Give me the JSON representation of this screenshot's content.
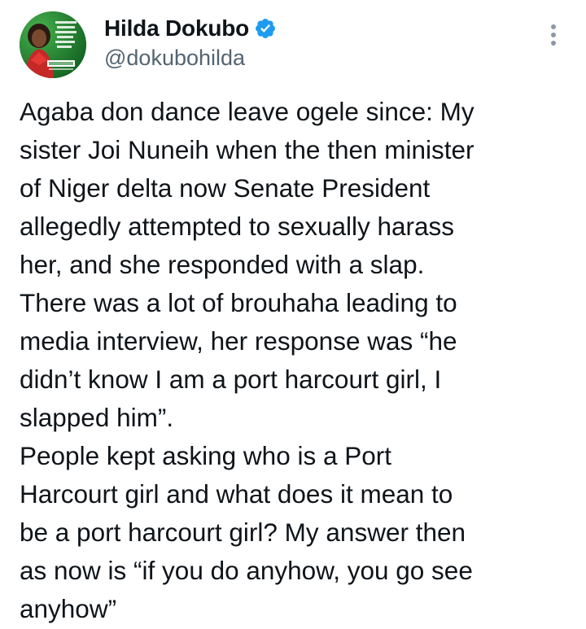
{
  "author": {
    "display_name": "Hilda Dokubo",
    "handle": "@dokubohilda",
    "verified": true,
    "avatar_icon": "profile-photo"
  },
  "menu": {
    "icon": "more-options-icon"
  },
  "tweet": {
    "lines": [
      "Agaba don dance leave ogele since: My",
      "sister Joi Nuneih when the then minister",
      "of Niger delta now Senate President",
      "allegedly attempted to sexually harass",
      "her, and she responded with a slap.",
      "There was a lot of brouhaha leading to",
      "media interview, her response was “he",
      "didn’t know I am a port harcourt girl, I",
      "slapped him”.",
      "People kept asking who is a Port",
      "Harcourt girl and what does it mean to",
      "be a port harcourt girl? My answer then",
      "as now is “if you do anyhow, you go see",
      "anyhow”"
    ]
  },
  "colors": {
    "verified_badge": "#1d9bf0",
    "text_primary": "#0f1419",
    "text_secondary": "#536471",
    "avatar_green": "#1d7a2c"
  }
}
